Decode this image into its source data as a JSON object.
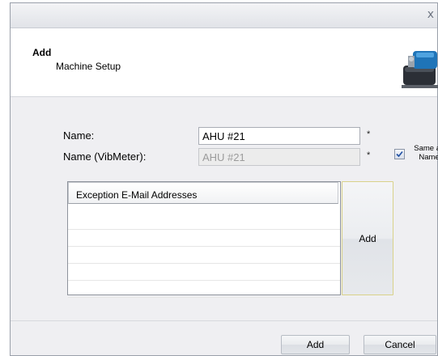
{
  "window": {
    "close_glyph": "x"
  },
  "header": {
    "title": "Add",
    "subtitle": "Machine Setup",
    "icon": "pump-icon"
  },
  "form": {
    "name_label": "Name:",
    "name_value": "AHU #21",
    "vib_label": "Name (VibMeter):",
    "vib_value": "AHU #21",
    "required_mark": "*",
    "same_as_line1": "Same as",
    "same_as_line2": "Name",
    "same_as_checked": true
  },
  "email_list": {
    "header": "Exception E-Mail Addresses",
    "add_label": "Add"
  },
  "footer": {
    "add_label": "Add",
    "cancel_label": "Cancel"
  },
  "colors": {
    "window_bg": "#efeff2",
    "accent_border": "#d9d28a",
    "check_mark": "#1f4fa3"
  }
}
